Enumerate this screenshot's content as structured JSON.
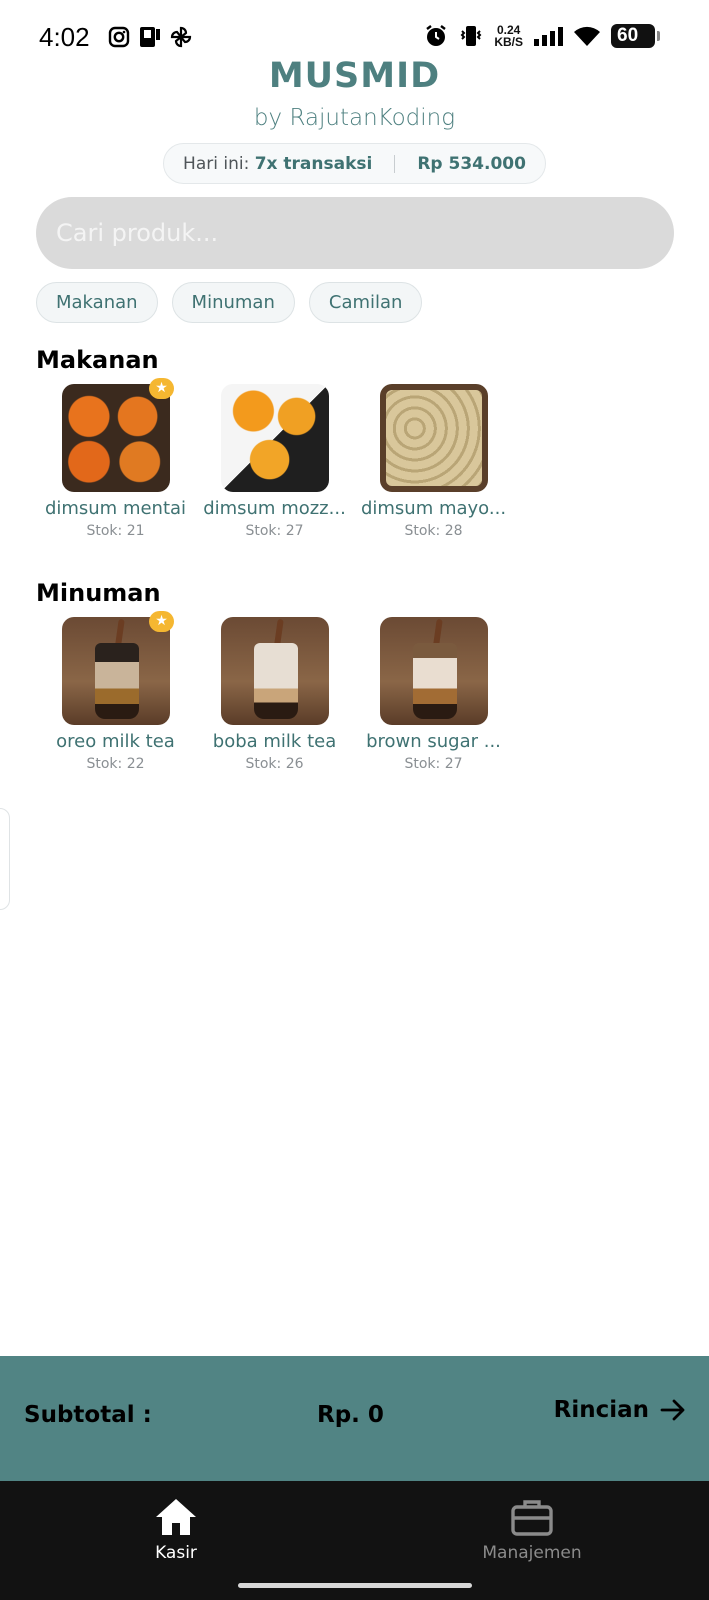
{
  "status_bar": {
    "time": "4:02",
    "net_speed_value": "0.24",
    "net_speed_unit": "KB/S",
    "battery": "60",
    "left_icons": [
      "instagram-icon",
      "notification-app-icon",
      "pinwheel-icon"
    ],
    "right_icons": [
      "alarm-icon",
      "vibrate-icon",
      "signal-icon",
      "wifi-icon",
      "battery-icon"
    ]
  },
  "header": {
    "title": "MUSMID",
    "subtitle": "by RajutanKoding",
    "summary": {
      "label": "Hari ini:",
      "transactions": "7x transaksi",
      "amount": "Rp 534.000"
    }
  },
  "search": {
    "placeholder": "Cari produk..."
  },
  "categories": [
    "Makanan",
    "Minuman",
    "Camilan"
  ],
  "sections": [
    {
      "title": "Makanan",
      "products": [
        {
          "name": "dimsum mentai",
          "stock": "Stok: 21",
          "featured": true
        },
        {
          "name": "dimsum mozz...",
          "stock": "Stok: 27",
          "featured": false
        },
        {
          "name": "dimsum mayo...",
          "stock": "Stok: 28",
          "featured": false
        }
      ]
    },
    {
      "title": "Minuman",
      "products": [
        {
          "name": "oreo milk tea",
          "stock": "Stok: 22",
          "featured": true
        },
        {
          "name": "boba milk tea",
          "stock": "Stok: 26",
          "featured": false
        },
        {
          "name": "brown sugar ...",
          "stock": "Stok: 27",
          "featured": false
        }
      ]
    }
  ],
  "subtotal": {
    "label": "Subtotal :",
    "value": "Rp. 0",
    "details_label": "Rincian"
  },
  "bottom_nav": {
    "items": [
      {
        "label": "Kasir",
        "icon": "home-icon",
        "active": true
      },
      {
        "label": "Manajemen",
        "icon": "briefcase-icon",
        "active": false
      }
    ]
  },
  "colors": {
    "accent": "#4e8080",
    "subtotal_bar": "#518484",
    "nav_bg": "#121212",
    "badge": "#f5b731"
  }
}
